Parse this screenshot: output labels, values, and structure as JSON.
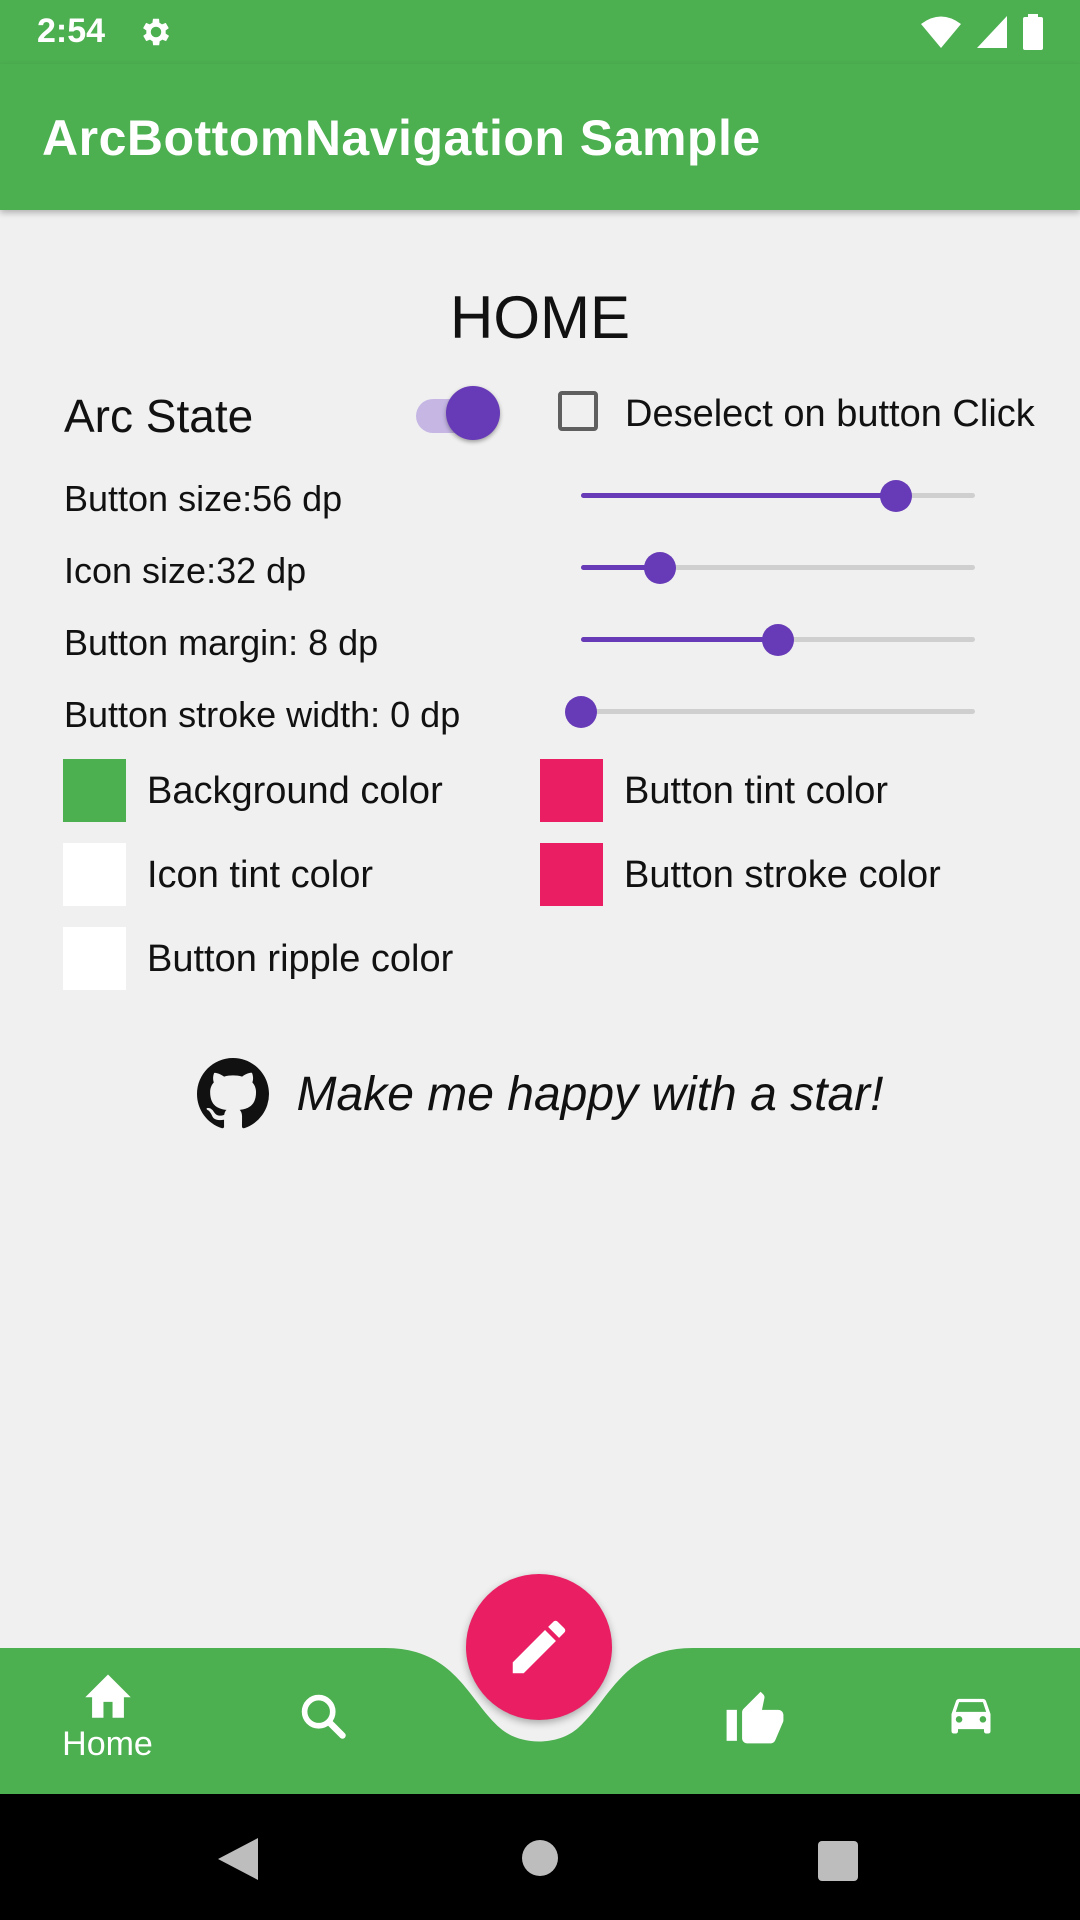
{
  "status_bar": {
    "time": "2:54"
  },
  "app_bar": {
    "title": "ArcBottomNavigation Sample"
  },
  "page": {
    "title": "HOME"
  },
  "arc_state": {
    "label": "Arc State",
    "on": true
  },
  "deselect": {
    "label": "Deselect on button Click",
    "checked": false
  },
  "sliders": [
    {
      "label": "Button size:56 dp",
      "fraction": 0.8
    },
    {
      "label": "Icon size:32 dp",
      "fraction": 0.2
    },
    {
      "label": "Button margin: 8 dp",
      "fraction": 0.5
    },
    {
      "label": "Button stroke width: 0 dp",
      "fraction": 0.0
    }
  ],
  "colors": {
    "background": {
      "label": "Background color",
      "value": "#4caf50"
    },
    "button_tint": {
      "label": "Button tint color",
      "value": "#e91e63"
    },
    "icon_tint": {
      "label": "Icon tint color",
      "value": "#ffffff"
    },
    "button_stroke": {
      "label": "Button stroke color",
      "value": "#e91e63"
    },
    "button_ripple": {
      "label": "Button ripple color",
      "value": "#ffffff"
    }
  },
  "star": {
    "text": "Make me happy with a star!",
    "icon": "github-icon"
  },
  "bottom_nav": {
    "items": [
      {
        "icon": "home-icon",
        "label": "Home",
        "selected": true
      },
      {
        "icon": "search-icon",
        "label": ""
      },
      {
        "icon": "thumb-up-icon",
        "label": ""
      },
      {
        "icon": "car-icon",
        "label": ""
      }
    ],
    "fab_icon": "pencil-icon"
  },
  "theme": {
    "primary": "#4caf50",
    "accent": "#673ab7",
    "fab": "#e91e63"
  }
}
